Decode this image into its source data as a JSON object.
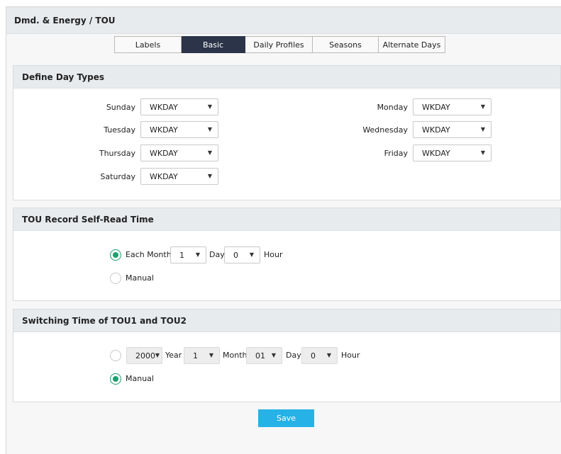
{
  "header": {
    "title": "Dmd. & Energy / TOU"
  },
  "tabs": [
    {
      "label": "Labels"
    },
    {
      "label": "Basic"
    },
    {
      "label": "Daily Profiles"
    },
    {
      "label": "Seasons"
    },
    {
      "label": "Alternate Days"
    }
  ],
  "active_tab": "Basic",
  "day_types": {
    "title": "Define Day Types",
    "days": [
      {
        "label": "Sunday",
        "value": "WKDAY"
      },
      {
        "label": "Monday",
        "value": "WKDAY"
      },
      {
        "label": "Tuesday",
        "value": "WKDAY"
      },
      {
        "label": "Wednesday",
        "value": "WKDAY"
      },
      {
        "label": "Thursday",
        "value": "WKDAY"
      },
      {
        "label": "Friday",
        "value": "WKDAY"
      },
      {
        "label": "Saturday",
        "value": "WKDAY"
      }
    ]
  },
  "self_read": {
    "title": "TOU Record Self-Read Time",
    "each_month_label": "Each Month",
    "day_value": "1",
    "day_label": "Day",
    "hour_value": "0",
    "hour_label": "Hour",
    "manual_label": "Manual",
    "selected": "each_month"
  },
  "switching": {
    "title": "Switching Time of TOU1 and TOU2",
    "year_value": "2000",
    "year_label": "Year",
    "month_value": "1",
    "month_label": "Month",
    "day_value": "01",
    "day_label": "Day",
    "hour_value": "0",
    "hour_label": "Hour",
    "manual_label": "Manual",
    "selected": "manual"
  },
  "footer": {
    "save_label": "Save"
  },
  "colors": {
    "accent": "#26b2e6",
    "tab_active": "#2b3448",
    "radio_on": "#1e9f6e"
  },
  "icons": {
    "caret": "caret-down-icon"
  }
}
